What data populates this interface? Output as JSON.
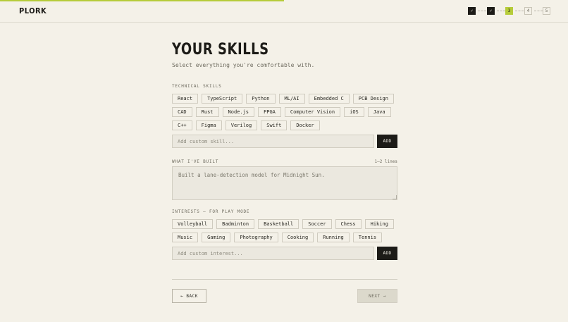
{
  "app": {
    "logo": "PLORK"
  },
  "steps": [
    {
      "label": "✓",
      "state": "done"
    },
    {
      "label": "✓",
      "state": "done"
    },
    {
      "label": "3",
      "state": "current"
    },
    {
      "label": "4",
      "state": "upcoming"
    },
    {
      "label": "5",
      "state": "upcoming"
    }
  ],
  "page": {
    "title": "YOUR SKILLS",
    "subtitle": "Select everything you're comfortable with."
  },
  "technical": {
    "label": "TECHNICAL SKILLS",
    "skills": [
      "React",
      "TypeScript",
      "Python",
      "ML/AI",
      "Embedded C",
      "PCB Design",
      "CAD",
      "Rust",
      "Node.js",
      "FPGA",
      "Computer Vision",
      "iOS",
      "Java",
      "C++",
      "Figma",
      "Verilog",
      "Swift",
      "Docker"
    ],
    "custom_placeholder": "Add custom skill...",
    "add_label": "ADD"
  },
  "built": {
    "label": "WHAT I'VE BUILT",
    "hint": "1–2 lines",
    "placeholder": "Built a lane-detection model for Midnight Sun."
  },
  "interests": {
    "label": "INTERESTS — for Play Mode",
    "items": [
      "Volleyball",
      "Badminton",
      "Basketball",
      "Soccer",
      "Chess",
      "Hiking",
      "Music",
      "Gaming",
      "Photography",
      "Cooking",
      "Running",
      "Tennis"
    ],
    "custom_placeholder": "Add custom interest...",
    "add_label": "ADD"
  },
  "nav": {
    "back_label": "← BACK",
    "next_label": "NEXT →"
  },
  "colors": {
    "background": "#f4f1e8",
    "accent": "#b6cc3a",
    "dark": "#1c1b17"
  }
}
